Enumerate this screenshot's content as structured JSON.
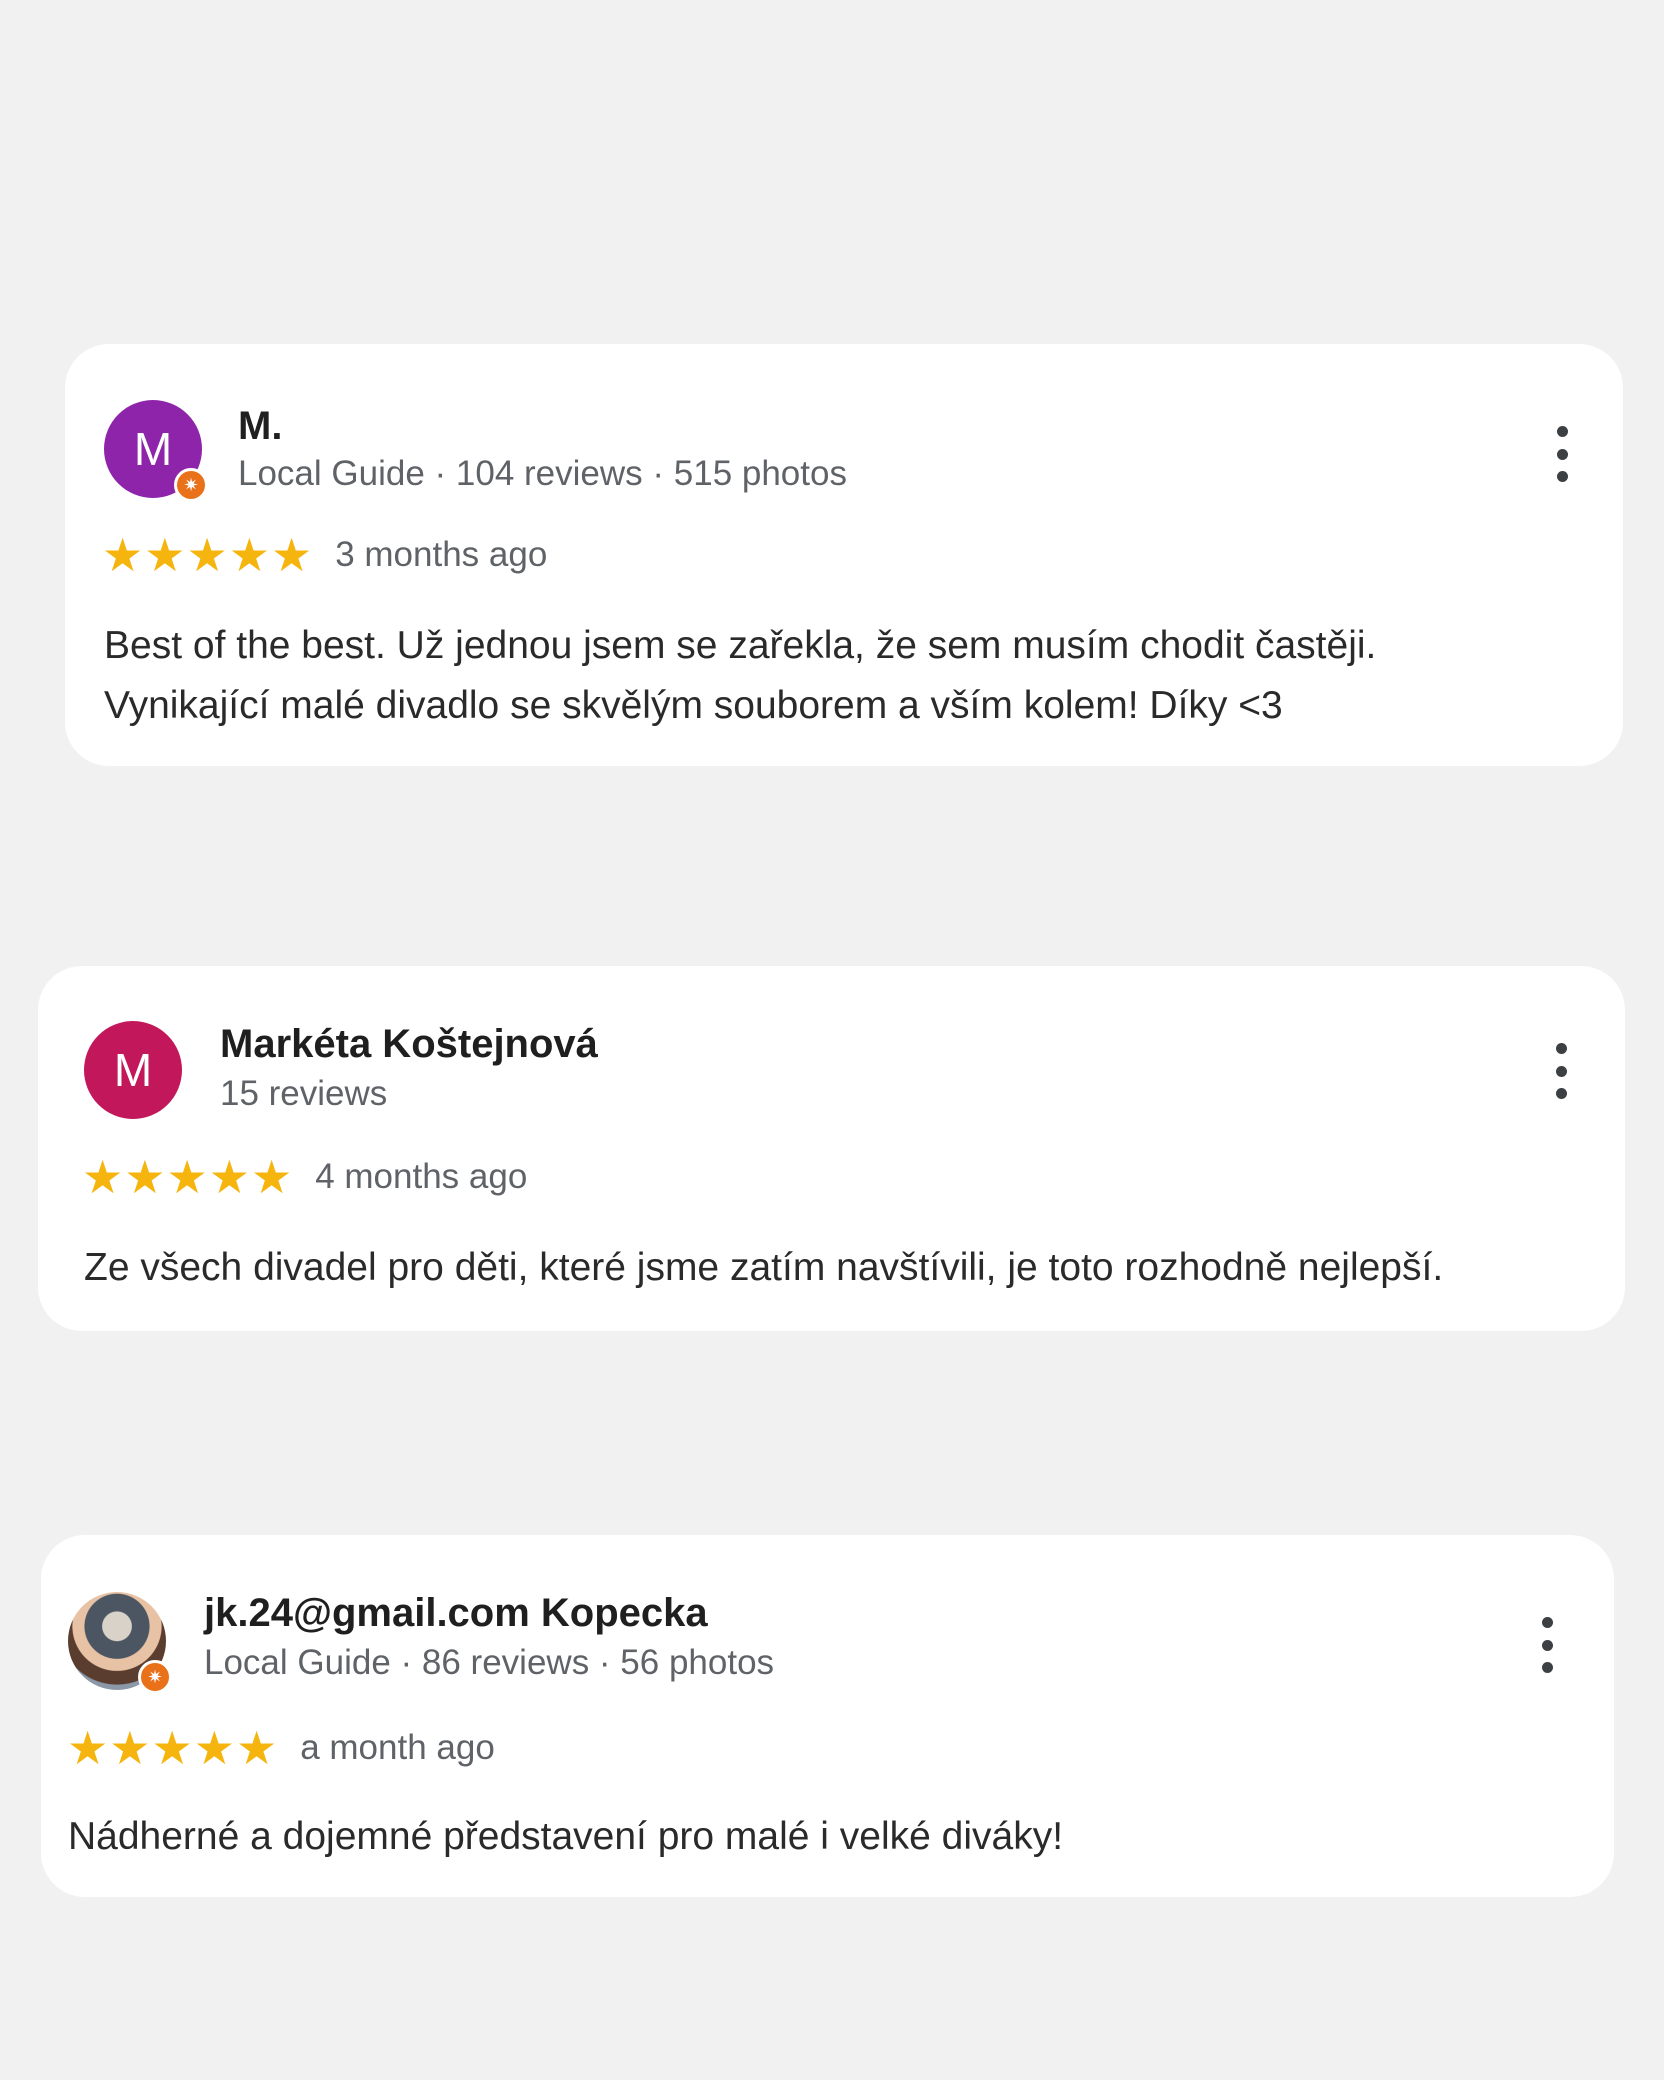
{
  "reviews": [
    {
      "avatar_letter": "M",
      "avatar_color": "#8e24aa",
      "local_guide_badge": true,
      "name": "M.",
      "meta": "Local Guide · 104 reviews · 515 photos",
      "stars": "★★★★★",
      "rating": 5,
      "date": "3 months ago",
      "text": "Best of the best. Už jednou jsem se zařekla, že sem musím chodit častěji.\nVynikající malé divadlo se skvělým souborem a vším kolem! Díky <3",
      "more_icon": "more-vert-icon"
    },
    {
      "avatar_letter": "M",
      "avatar_color": "#c2185b",
      "local_guide_badge": false,
      "name": "Markéta Koštejnová",
      "meta": "15 reviews",
      "stars": "★★★★★",
      "rating": 5,
      "date": "4 months ago",
      "text": "Ze všech divadel pro děti, které jsme zatím navštívili, je toto rozhodně nejlepší.",
      "more_icon": "more-vert-icon"
    },
    {
      "avatar_letter": "",
      "avatar_color": "",
      "local_guide_badge": true,
      "name": "jk.24@gmail.com Kopecka",
      "meta": "Local Guide · 86 reviews · 56 photos",
      "stars": "★★★★★",
      "rating": 5,
      "date": "a month ago",
      "text": "Nádherné a dojemné představení pro malé i velké diváky!",
      "more_icon": "more-vert-icon"
    }
  ],
  "badge_icon": "star-badge-icon",
  "badge_glyph": "✷"
}
